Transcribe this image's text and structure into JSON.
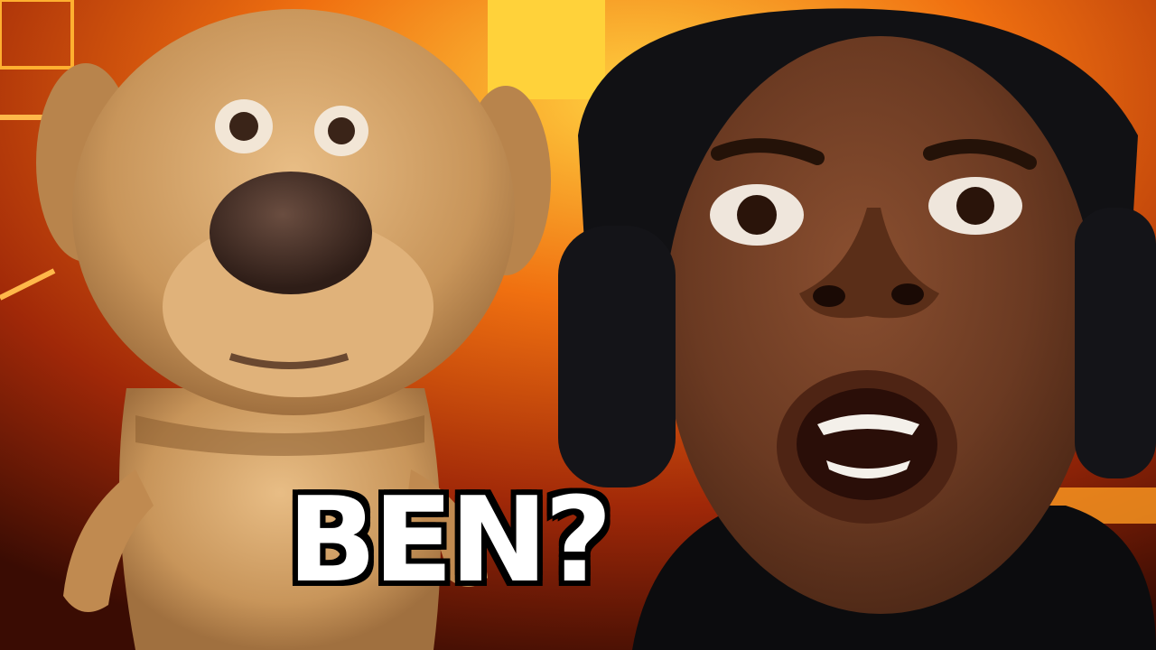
{
  "thumbnail": {
    "caption": "BEN?"
  },
  "colors": {
    "background_glow": "#ffb020",
    "background_dark": "#5a1405",
    "dog_fur": "#c8955a",
    "dog_fur_light": "#e3b47b",
    "dog_nose": "#3e2a22",
    "person_skin": "#6b3a22",
    "headphones": "#141418",
    "shirt": "#0c0c0e",
    "caption_fill": "#ffffff",
    "caption_outline": "#000000"
  }
}
